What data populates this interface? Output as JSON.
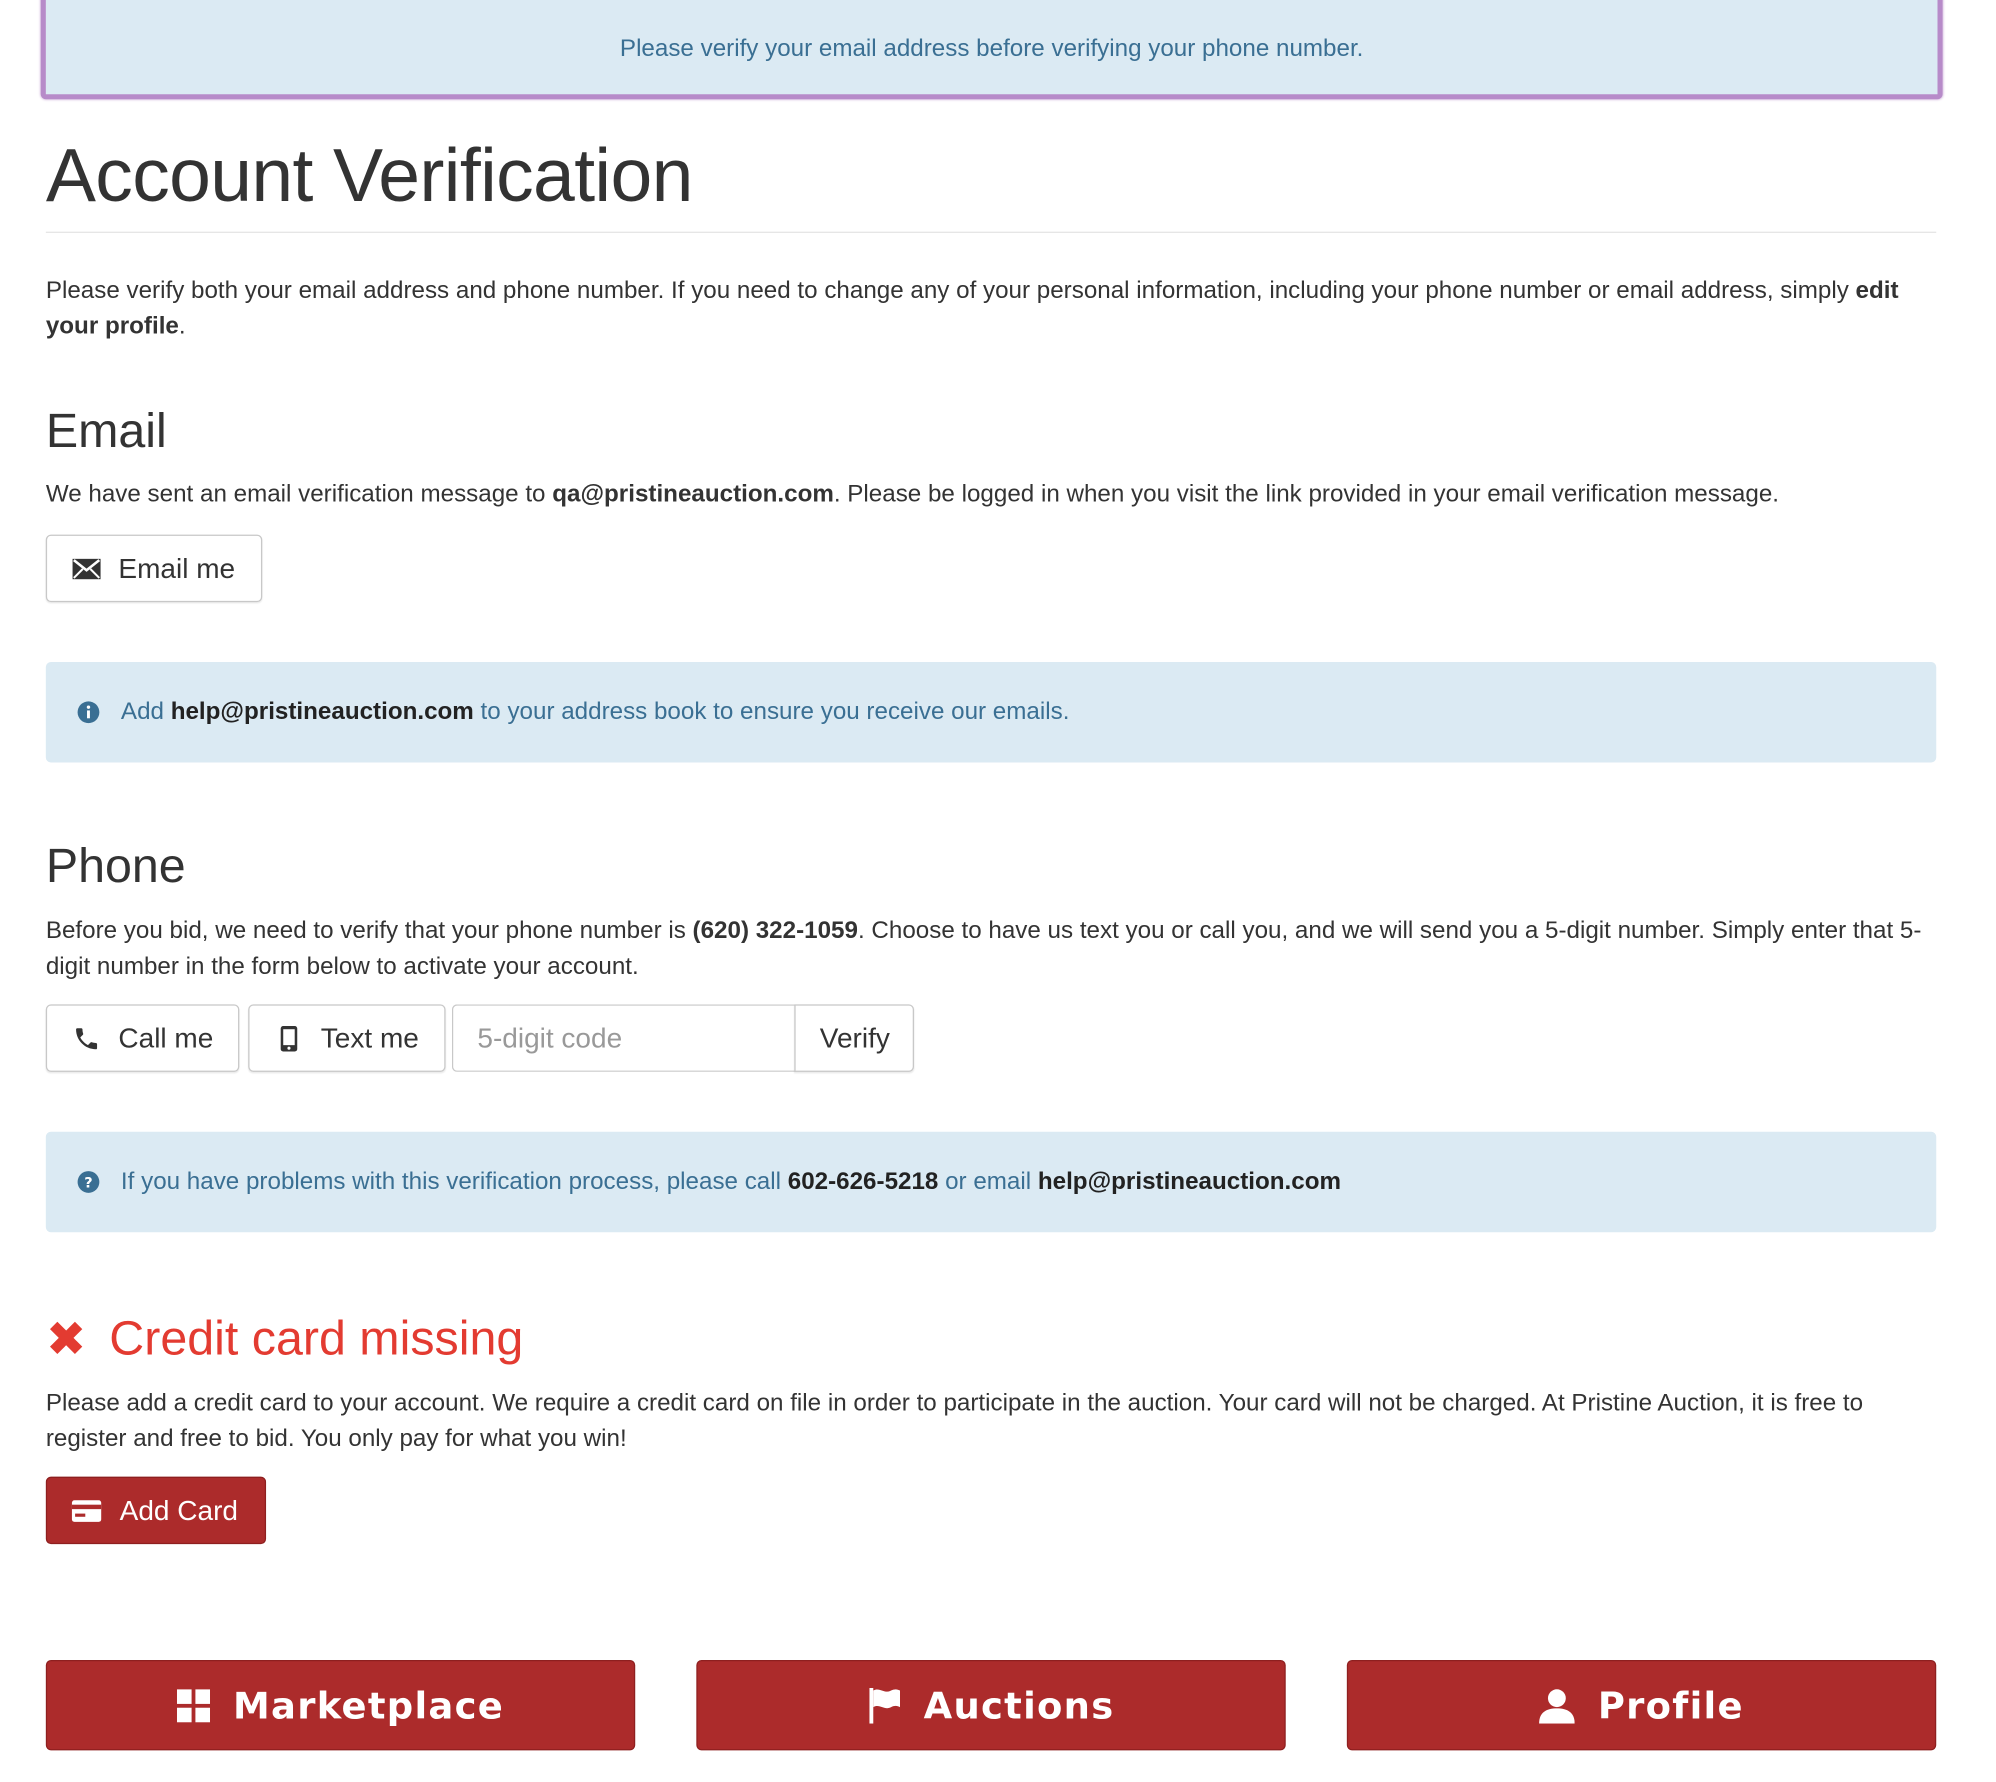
{
  "top_alert": {
    "text": "Please verify your email address before verifying your phone number."
  },
  "page": {
    "title": "Account Verification",
    "intro_text": "Please verify both your email address and phone number. If you need to change any of your personal information, including your phone number or email address, simply ",
    "intro_link": "edit your profile",
    "intro_end": "."
  },
  "email": {
    "heading": "Email",
    "text_before": "We have sent an email verification message to ",
    "address": "qa@pristineauction.com",
    "text_after": ". Please be logged in when you visit the link provided in your email verification message.",
    "button_label": "Email me",
    "info_before": "Add ",
    "info_address": "help@pristineauction.com",
    "info_after": " to your address book to ensure you receive our emails."
  },
  "phone": {
    "heading": "Phone",
    "text_before": "Before you bid, we need to verify that your phone number is ",
    "number": "(620) 322-1059",
    "text_after": ". Choose to have us text you or call you, and we will send you a 5-digit number. Simply enter that 5-digit number in the form below to activate your account.",
    "call_label": "Call me",
    "text_label": "Text me",
    "code_placeholder": "5-digit code",
    "verify_label": "Verify",
    "help_before": "If you have problems with this verification process, please call ",
    "help_phone": "602-626-5218",
    "help_middle": " or email ",
    "help_email": "help@pristineauction.com"
  },
  "credit_card": {
    "icon": "✖",
    "heading": "Credit card missing",
    "text": "Please add a credit card to your account. We require a credit card on file in order to participate in the auction. Your card will not be charged. At Pristine Auction, it is free to register and free to bid. You only pay for what you win!",
    "button_label": "Add Card"
  },
  "nav": {
    "marketplace": "Marketplace",
    "auctions": "Auctions",
    "profile": "Profile"
  },
  "colors": {
    "alert_bg": "#dbeaf3",
    "alert_text": "#3a6f93",
    "danger": "#e33b31",
    "brand_red": "#ac2b2b"
  }
}
